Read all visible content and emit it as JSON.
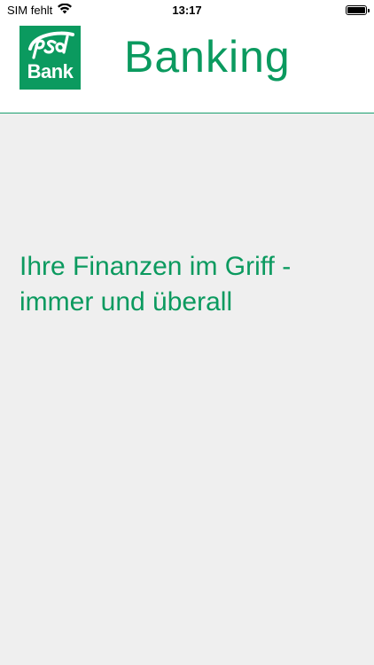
{
  "status_bar": {
    "carrier": "SIM fehlt",
    "time": "13:17",
    "battery_level": 1.0
  },
  "header": {
    "logo_top_text": "psd",
    "logo_bottom_text": "Bank",
    "title": "Banking"
  },
  "main": {
    "tagline_line1": "Ihre Finanzen im Griff -",
    "tagline_line2": "immer und überall"
  },
  "colors": {
    "brand_green": "#0b9a5f",
    "background": "#efefef",
    "header_background": "#ffffff"
  }
}
